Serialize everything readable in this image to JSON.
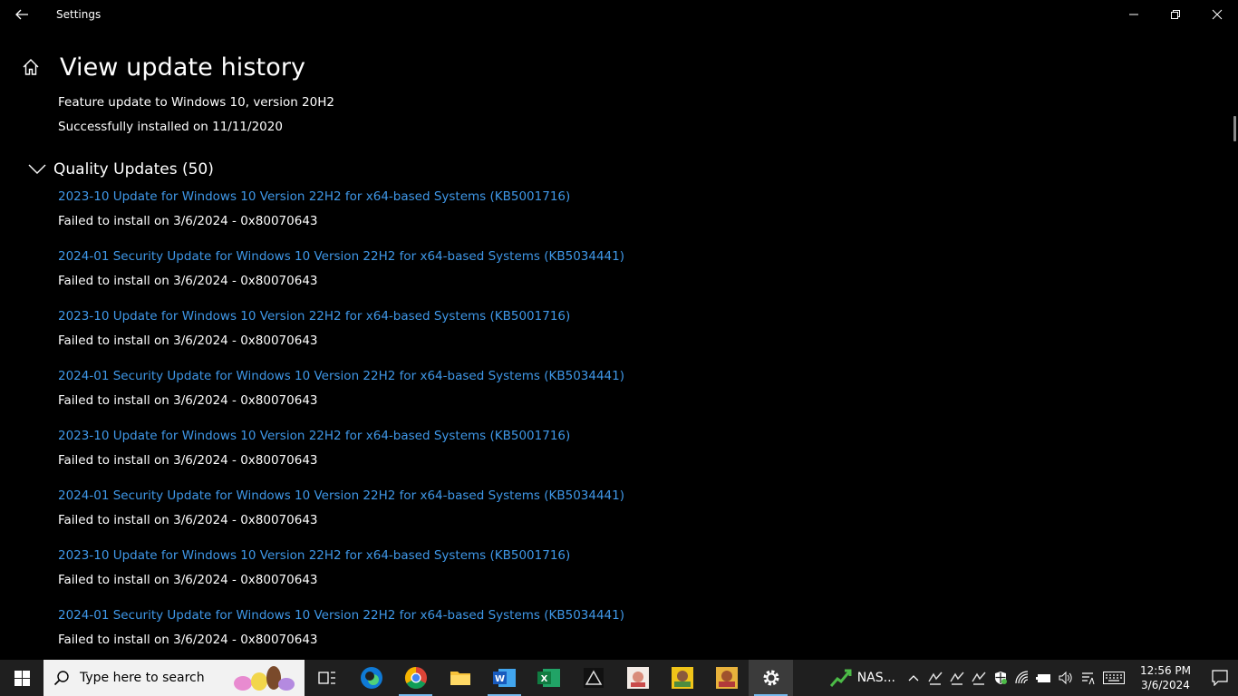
{
  "window": {
    "title": "Settings"
  },
  "page": {
    "title": "View update history"
  },
  "feature": {
    "title": "Feature update to Windows 10, version 20H2",
    "status": "Successfully installed on 11/11/2020"
  },
  "quality": {
    "label": "Quality Updates (50)",
    "items": [
      {
        "title": "2023-10 Update for Windows 10 Version 22H2 for x64-based Systems (KB5001716)",
        "status": "Failed to install on 3/6/2024 - 0x80070643"
      },
      {
        "title": "2024-01 Security Update for Windows 10 Version 22H2 for x64-based Systems (KB5034441)",
        "status": "Failed to install on 3/6/2024 - 0x80070643"
      },
      {
        "title": "2023-10 Update for Windows 10 Version 22H2 for x64-based Systems (KB5001716)",
        "status": "Failed to install on 3/6/2024 - 0x80070643"
      },
      {
        "title": "2024-01 Security Update for Windows 10 Version 22H2 for x64-based Systems (KB5034441)",
        "status": "Failed to install on 3/6/2024 - 0x80070643"
      },
      {
        "title": "2023-10 Update for Windows 10 Version 22H2 for x64-based Systems (KB5001716)",
        "status": "Failed to install on 3/6/2024 - 0x80070643"
      },
      {
        "title": "2024-01 Security Update for Windows 10 Version 22H2 for x64-based Systems (KB5034441)",
        "status": "Failed to install on 3/6/2024 - 0x80070643"
      },
      {
        "title": "2023-10 Update for Windows 10 Version 22H2 for x64-based Systems (KB5001716)",
        "status": "Failed to install on 3/6/2024 - 0x80070643"
      },
      {
        "title": "2024-01 Security Update for Windows 10 Version 22H2 for x64-based Systems (KB5034441)",
        "status": "Failed to install on 3/6/2024 - 0x80070643"
      }
    ]
  },
  "taskbar": {
    "search_placeholder": "Type here to search",
    "tray_app_label": "NAS...",
    "time": "12:56 PM",
    "date": "3/6/2024"
  },
  "colors": {
    "link": "#3f98e8",
    "background": "#000000",
    "taskbar": "#1f1f1f"
  }
}
